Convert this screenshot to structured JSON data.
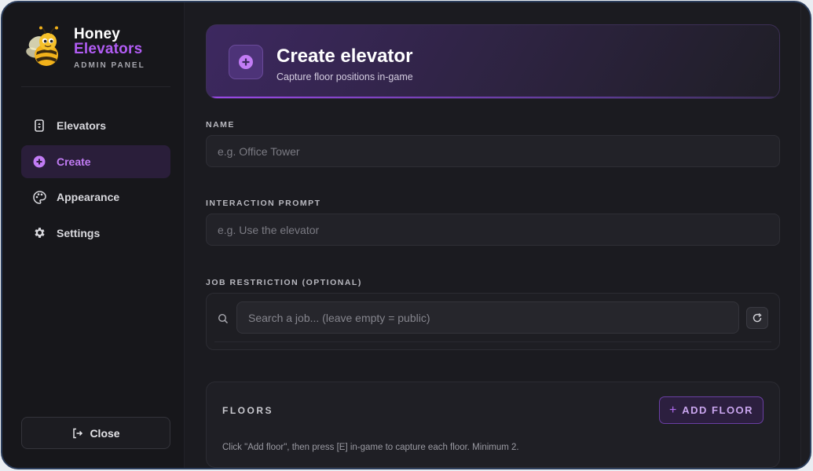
{
  "brand": {
    "line1": "Honey",
    "line2": "Elevators",
    "subtitle": "ADMIN PANEL",
    "logo_icon": "bee-icon"
  },
  "sidebar": {
    "items": [
      {
        "label": "Elevators",
        "icon": "elevator-icon",
        "active": false
      },
      {
        "label": "Create",
        "icon": "plus-circle-icon",
        "active": true
      },
      {
        "label": "Appearance",
        "icon": "palette-icon",
        "active": false
      },
      {
        "label": "Settings",
        "icon": "gear-icon",
        "active": false
      }
    ],
    "close_label": "Close"
  },
  "header": {
    "title": "Create elevator",
    "subtitle": "Capture floor positions in-game"
  },
  "form": {
    "name_label": "NAME",
    "name_placeholder": "e.g. Office Tower",
    "prompt_label": "INTERACTION PROMPT",
    "prompt_placeholder": "e.g. Use the elevator",
    "job_label": "JOB RESTRICTION (OPTIONAL)",
    "job_placeholder": "Search a job... (leave empty = public)"
  },
  "floors": {
    "title": "FLOORS",
    "add_label": "ADD FLOOR",
    "hint": "Click \"Add floor\", then press [E] in-game to capture each floor. Minimum 2."
  },
  "colors": {
    "accent": "#b15cf3",
    "background": "#1b1b20",
    "sidebar": "#17171b",
    "active_nav_bg": "#2a1e3a"
  }
}
